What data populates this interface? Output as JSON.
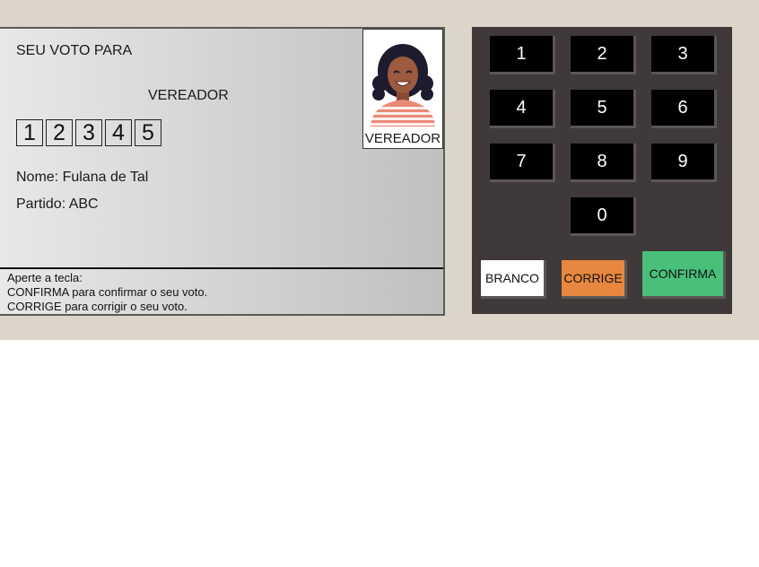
{
  "screen": {
    "header": "SEU VOTO PARA",
    "cargo": "VEREADOR",
    "digits": [
      "1",
      "2",
      "3",
      "4",
      "5"
    ],
    "nome": "Nome: Fulana de Tal",
    "partido": "Partido: ABC",
    "photo_label": "VEREADOR",
    "instructions": {
      "line1": "Aperte a tecla:",
      "line2": "CONFIRMA para confirmar o seu voto.",
      "line3": "CORRIGE para corrigir o seu voto."
    }
  },
  "keypad": {
    "keys": [
      "1",
      "2",
      "3",
      "4",
      "5",
      "6",
      "7",
      "8",
      "9",
      "0"
    ],
    "branco": "BRANCO",
    "corrige": "CORRIGE",
    "confirma": "CONFIRMA"
  },
  "colors": {
    "background": "#dcd5ca",
    "keypad": "#3f3939",
    "key": "#000000",
    "branco": "#ffffff",
    "corrige": "#e8873f",
    "confirma": "#48c07a"
  }
}
